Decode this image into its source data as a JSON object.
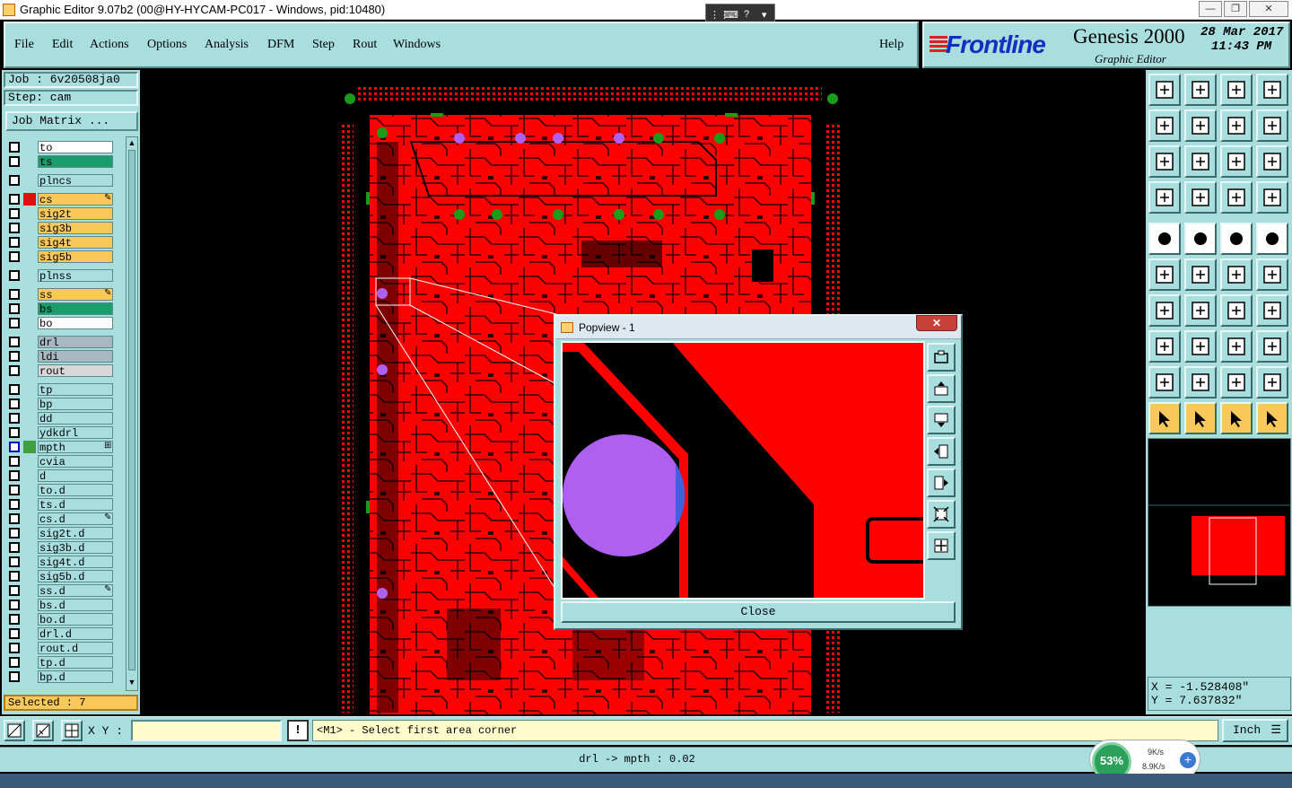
{
  "window": {
    "title": "Graphic Editor 9.07b2 (00@HY-HYCAM-PC017 - Windows, pid:10480)",
    "minimize": "—",
    "restore": "❐",
    "close": "✕"
  },
  "menu": {
    "items": [
      "File",
      "Edit",
      "Actions",
      "Options",
      "Analysis",
      "DFM",
      "Step",
      "Rout",
      "Windows"
    ],
    "help": "Help"
  },
  "brand": {
    "logo": "Frontline",
    "product": "Genesis 2000",
    "subtitle": "Graphic Editor",
    "date": "28 Mar 2017",
    "time": "11:43 PM"
  },
  "left": {
    "job": "Job : 6v20508ja0",
    "step": "Step: cam",
    "job_matrix": "Job Matrix ...",
    "selected": "Selected : 7"
  },
  "layers": [
    {
      "name": "to",
      "color": "#ffffff"
    },
    {
      "name": "ts",
      "color": "#1a9c6c"
    },
    {
      "name": "plncs",
      "color": "#a8dede",
      "gap": true
    },
    {
      "name": "cs",
      "color": "#f8c85a",
      "gap": true,
      "flag": "✎",
      "mark": "#e01010"
    },
    {
      "name": "sig2t",
      "color": "#f8c85a"
    },
    {
      "name": "sig3b",
      "color": "#f8c85a"
    },
    {
      "name": "sig4t",
      "color": "#f8c85a"
    },
    {
      "name": "sig5b",
      "color": "#f8c85a"
    },
    {
      "name": "plnss",
      "color": "#a8dede",
      "gap": true
    },
    {
      "name": "ss",
      "color": "#f8c85a",
      "gap": true,
      "flag": "✎"
    },
    {
      "name": "bs",
      "color": "#1a9c6c"
    },
    {
      "name": "bo",
      "color": "#ffffff"
    },
    {
      "name": "drl",
      "color": "#a8b8c0",
      "gap": true
    },
    {
      "name": "ldi",
      "color": "#a8b8c0"
    },
    {
      "name": "rout",
      "color": "#d8d8d8"
    },
    {
      "name": "tp",
      "color": "#a8dede",
      "gap": true
    },
    {
      "name": "bp",
      "color": "#a8dede"
    },
    {
      "name": "dd",
      "color": "#a8dede"
    },
    {
      "name": "ydkdrl",
      "color": "#a8dede"
    },
    {
      "name": "mpth",
      "color": "#a8dede",
      "flag": "⊞",
      "mark": "#40a040",
      "active": true
    },
    {
      "name": "cvia",
      "color": "#a8dede"
    },
    {
      "name": "d",
      "color": "#a8dede"
    },
    {
      "name": "to.d",
      "color": "#a8dede"
    },
    {
      "name": "ts.d",
      "color": "#a8dede"
    },
    {
      "name": "cs.d",
      "color": "#a8dede",
      "flag": "✎"
    },
    {
      "name": "sig2t.d",
      "color": "#a8dede"
    },
    {
      "name": "sig3b.d",
      "color": "#a8dede"
    },
    {
      "name": "sig4t.d",
      "color": "#a8dede"
    },
    {
      "name": "sig5b.d",
      "color": "#a8dede"
    },
    {
      "name": "ss.d",
      "color": "#a8dede",
      "flag": "✎"
    },
    {
      "name": "bs.d",
      "color": "#a8dede"
    },
    {
      "name": "bo.d",
      "color": "#a8dede"
    },
    {
      "name": "drl.d",
      "color": "#a8dede"
    },
    {
      "name": "rout.d",
      "color": "#a8dede"
    },
    {
      "name": "tp.d",
      "color": "#a8dede"
    },
    {
      "name": "bp.d",
      "color": "#a8dede"
    }
  ],
  "popview": {
    "title": "Popview - 1",
    "close_label": "Close",
    "close_x": "✕"
  },
  "coords": {
    "x": "X = -1.528408\"",
    "y": "Y = 7.637832\""
  },
  "command": {
    "xy_label": "X Y :",
    "xy_value": "",
    "exclaim": "!",
    "prompt": "<M1> - Select first area corner",
    "unit": "Inch"
  },
  "status": {
    "text": "drl -> mpth : 0.02"
  },
  "network": {
    "percent": "53%",
    "up": "9K/s",
    "down": "8.9K/s",
    "plus": "+"
  },
  "colors": {
    "board": "#ff0000",
    "pad_green": "#1a9c1a",
    "pad_purple": "#b060f0",
    "panel": "#a8dede"
  }
}
